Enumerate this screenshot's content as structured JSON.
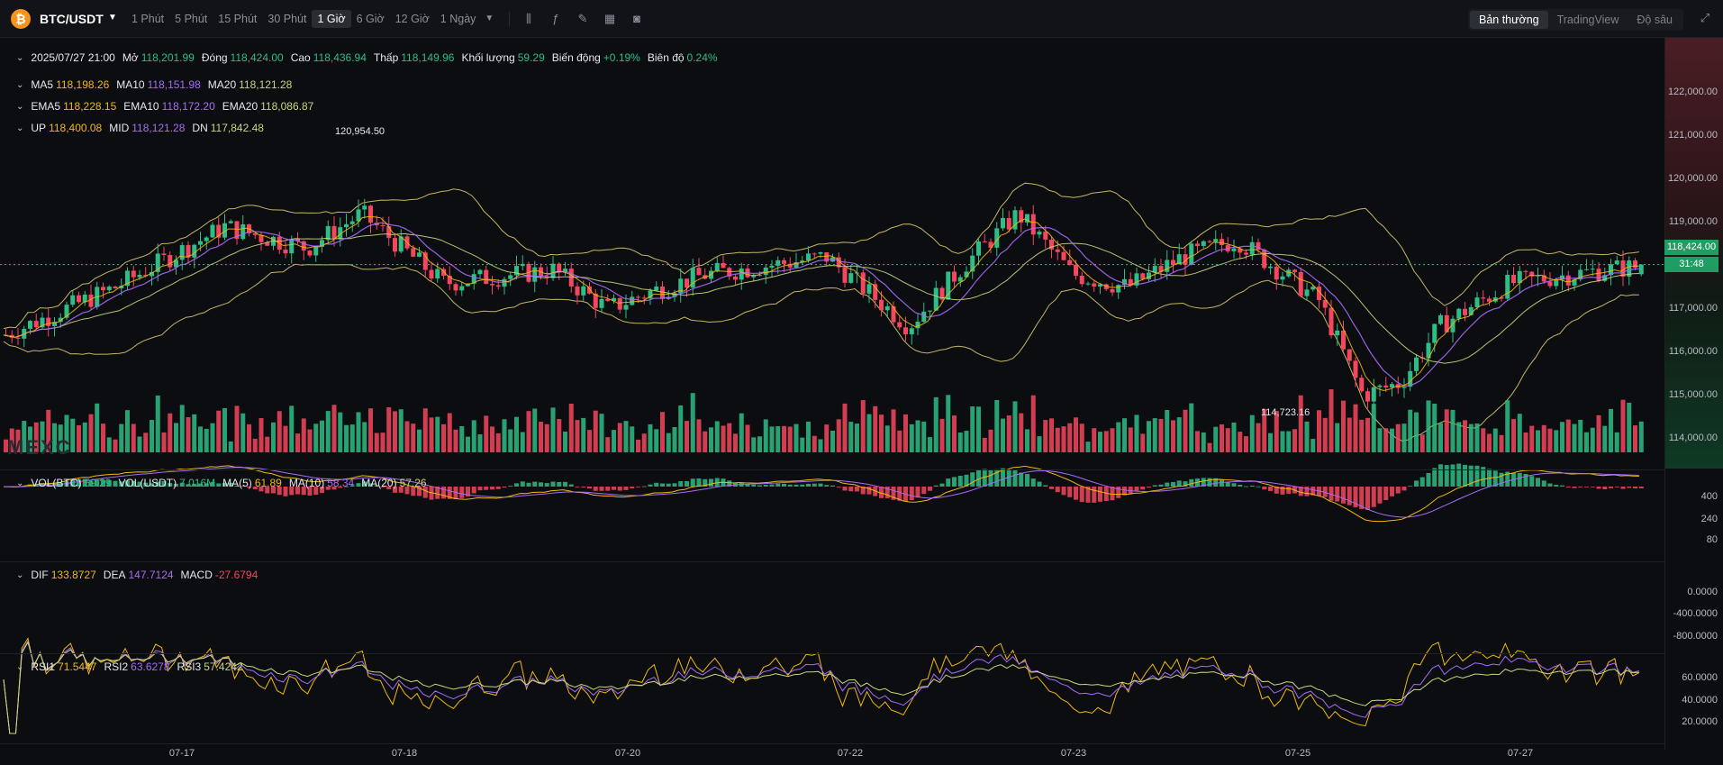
{
  "header": {
    "coin_icon": "bitcoin-icon",
    "pair": "BTC/USDT",
    "intervals": [
      "1 Phút",
      "5 Phút",
      "15 Phút",
      "30 Phút",
      "1 Giờ",
      "6 Giờ",
      "12 Giờ",
      "1 Ngày"
    ],
    "active_interval": "1 Giờ",
    "views": [
      "Bản thường",
      "TradingView",
      "Độ sâu"
    ],
    "active_view": "Bản thường",
    "tools": [
      "candle-type-icon",
      "indicator-icon",
      "draw-icon",
      "layout-icon",
      "camera-icon"
    ]
  },
  "ohlc": {
    "date": "2025/07/27 21:00",
    "open_label": "Mở",
    "open": "118,201.99",
    "close_label": "Đóng",
    "close": "118,424.00",
    "high_label": "Cao",
    "high": "118,436.94",
    "low_label": "Thấp",
    "low": "118,149.96",
    "volume_label": "Khối lượng",
    "volume": "59.29",
    "change_label": "Biến động",
    "change": "+0.19%",
    "amp_label": "Biên độ",
    "amp": "0.24%"
  },
  "ma": {
    "ma5_label": "MA5",
    "ma5": "118,198.26",
    "ma10_label": "MA10",
    "ma10": "118,151.98",
    "ma20_label": "MA20",
    "ma20": "118,121.28"
  },
  "ema": {
    "ema5_label": "EMA5",
    "ema5": "118,228.15",
    "ema10_label": "EMA10",
    "ema10": "118,172.20",
    "ema20_label": "EMA20",
    "ema20": "118,086.87"
  },
  "boll": {
    "up_label": "UP",
    "up": "118,400.08",
    "mid_label": "MID",
    "mid": "118,121.28",
    "dn_label": "DN",
    "dn": "117,842.48"
  },
  "vol": {
    "btc_label": "VOL(BTC)",
    "btc": "59.29",
    "usdt_label": "VOL(USDT)",
    "usdt": "7.016M",
    "ma5_label": "MA(5)",
    "ma5": "61.89",
    "ma10_label": "MA(10)",
    "ma10": "58.34",
    "ma20_label": "MA(20)",
    "ma20": "57.26"
  },
  "macd": {
    "dif_label": "DIF",
    "dif": "133.8727",
    "dea_label": "DEA",
    "dea": "147.7124",
    "macd_label": "MACD",
    "macd": "-27.6794"
  },
  "rsi": {
    "rsi1_label": "RSI1",
    "rsi1": "71.5447",
    "rsi2_label": "RSI2",
    "rsi2": "63.6278",
    "rsi3_label": "RSI3",
    "rsi3": "57.4242"
  },
  "price_axis": [
    "122,000.00",
    "121,000.00",
    "120,000.00",
    "119,000.00",
    "117,000.00",
    "116,000.00",
    "115,000.00",
    "114,000.00"
  ],
  "current_price": "118,424.00",
  "countdown": "31:48",
  "high_marker": "120,954.50",
  "low_marker": "114,723.16",
  "vol_axis": [
    "400",
    "240",
    "80"
  ],
  "macd_axis": [
    "0.0000",
    "-400.0000",
    "-800.0000"
  ],
  "rsi_axis": [
    "60.0000",
    "40.0000",
    "20.0000"
  ],
  "date_axis": [
    "07-17",
    "07-18",
    "07-20",
    "07-22",
    "07-23",
    "07-25",
    "07-27"
  ],
  "watermark": "MEXC",
  "colors": {
    "up": "#2ebd85",
    "down": "#f6465d",
    "ma5": "#f0b90b",
    "ma10": "#a56cf6",
    "ma20": "#c8d87a",
    "boll": "#d8c968"
  }
}
